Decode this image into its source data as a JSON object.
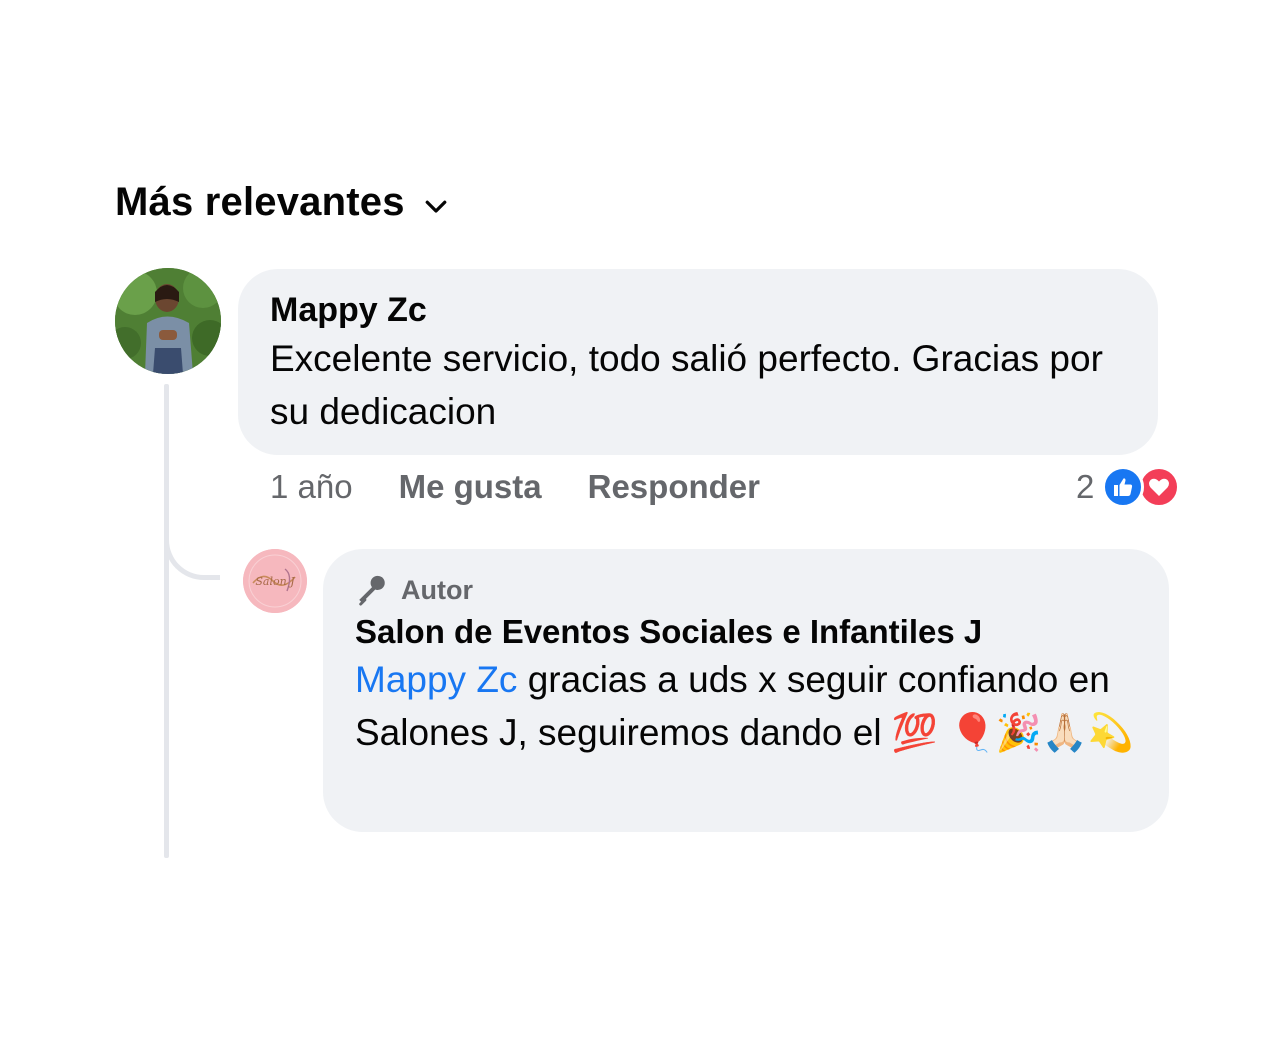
{
  "sort": {
    "label": "Más relevantes",
    "icon": "chevron-down-icon"
  },
  "comment": {
    "author": "Mappy Zc",
    "text": "Excelente servicio, todo salió perfecto. Gracias por su dedicacion",
    "time": "1 año",
    "like_label": "Me gusta",
    "reply_label": "Responder",
    "reaction_count": "2",
    "reactions": [
      "like-icon",
      "love-icon"
    ]
  },
  "reply": {
    "badge_icon": "microphone-icon",
    "badge_label": "Autor",
    "author": "Salon de Eventos Sociales e Infantiles J",
    "mention": "Mappy Zc",
    "text": " gracias a uds x seguir confiando en Salones J, seguiremos dando el ",
    "emojis": "💯 🎈🎉🙏🏻💫",
    "avatar_text": "Salon J"
  },
  "colors": {
    "mention": "#1877f2",
    "bubble": "#f0f2f5",
    "secondary_text": "#65676b",
    "like": "#1877f2",
    "love": "#f33e58"
  }
}
